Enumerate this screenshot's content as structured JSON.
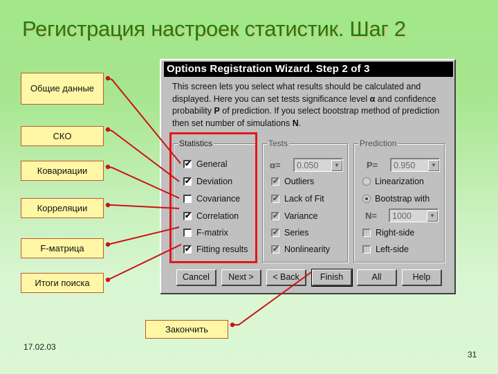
{
  "slide": {
    "title": "Регистрация настроек статистик. Шаг 2",
    "date": "17.02.03",
    "page_number": "31"
  },
  "callouts": [
    {
      "id": "general",
      "label": "Общие данные"
    },
    {
      "id": "deviation",
      "label": "СКО"
    },
    {
      "id": "covariance",
      "label": "Ковариации"
    },
    {
      "id": "correlation",
      "label": "Корреляции"
    },
    {
      "id": "fmatrix",
      "label": "F-матрица"
    },
    {
      "id": "fitting",
      "label": "Итоги поиска"
    },
    {
      "id": "finish",
      "label": "Закончить"
    }
  ],
  "colors": {
    "callout_fill": "#fff7a6",
    "callout_border": "#c0572c",
    "leader_line": "#cc1111",
    "highlight_frame": "#e01818",
    "title_text": "#1f7a0f"
  },
  "dialog": {
    "title": "Options Registration Wizard. Step 2 of 3",
    "description": {
      "line1": "This screen lets you select what results should be calculated and",
      "line2a": "displayed. Here you can set tests significance level ",
      "alpha_symbol": "α",
      "line2b": " and confidence",
      "line3a": "probability ",
      "p_symbol": "P",
      "line3b": " of prediction. If you select bootstrap method of prediction",
      "line4a": "then set number of simulations ",
      "n_symbol": "N",
      "line4b": "."
    },
    "statistics": {
      "label": "Statistics",
      "items": [
        {
          "label": "General",
          "checked": true,
          "mark": "✔"
        },
        {
          "label": "Deviation",
          "checked": true,
          "mark": "✔"
        },
        {
          "label": "Covariance",
          "checked": false,
          "mark": ""
        },
        {
          "label": "Correlation",
          "checked": true,
          "mark": "✔"
        },
        {
          "label": "F-matrix",
          "checked": false,
          "mark": ""
        },
        {
          "label": "Fitting results",
          "checked": true,
          "mark": "✔"
        }
      ]
    },
    "tests": {
      "label": "Tests",
      "alpha_label": "α=",
      "alpha_value": "0.050",
      "items": [
        {
          "label": "Outliers",
          "checked": true,
          "mark": "✔"
        },
        {
          "label": "Lack of Fit",
          "checked": true,
          "mark": "✔"
        },
        {
          "label": "Variance",
          "checked": true,
          "mark": "✔"
        },
        {
          "label": "Series",
          "checked": true,
          "mark": "✔"
        },
        {
          "label": "Nonlinearity",
          "checked": true,
          "mark": "✔"
        }
      ]
    },
    "prediction": {
      "label": "Prediction",
      "p_label": "P=",
      "p_value": "0.950",
      "method_options": [
        {
          "label": "Linearization",
          "selected": false
        },
        {
          "label": "Bootstrap with",
          "selected": true
        }
      ],
      "n_label": "N=",
      "n_value": "1000",
      "sides": [
        {
          "label": "Right-side",
          "checked": false,
          "mark": ""
        },
        {
          "label": "Left-side",
          "checked": false,
          "mark": ""
        }
      ]
    },
    "buttons": {
      "cancel": "Cancel",
      "next": "Next >",
      "back": "< Back",
      "finish": "Finish",
      "all": "All",
      "help": "Help"
    },
    "dropdown_arrow": "▼"
  }
}
